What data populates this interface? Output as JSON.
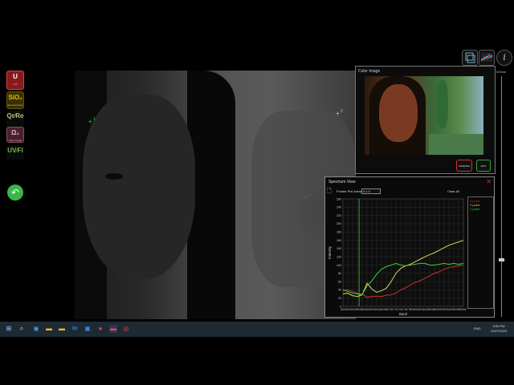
{
  "tools": [
    {
      "icon": "U",
      "label": "UVF",
      "icon_name": "uv-fluorescence-icon"
    },
    {
      "icon": "SiO₂",
      "label": "Spectral Cube",
      "icon_name": "spectral-cube-icon"
    },
    {
      "icon": "Qr⁄Re",
      "label": "",
      "icon_name": "ratio-icon"
    },
    {
      "icon": "Ω₂",
      "label": "Color Image",
      "icon_name": "color-image-icon"
    },
    {
      "icon": "UV⁄Fl",
      "label": "",
      "icon_name": "uv-icon"
    }
  ],
  "back_button": {
    "icon": "↶"
  },
  "markers": [
    {
      "id": "1",
      "color": "#3bd23b"
    },
    {
      "id": "2",
      "color": "#d8d85a"
    },
    {
      "id": "3",
      "color": "#d03030"
    }
  ],
  "top_right_icons": {
    "layers": "layers-icon",
    "spectrum": "spectrum-icon",
    "info": "i"
  },
  "color_image": {
    "title": "Color Image",
    "btn_1": "SAVE/IMG",
    "btn_2": "EXIT"
  },
  "scale": {
    "label": "500nm"
  },
  "spectrum_view": {
    "title": "Spectrum View",
    "close_icon": "✕",
    "mode_label": "Pointer Pixl Areas:",
    "mode_value": "4 x 4",
    "clear_all": "Clear All",
    "legend": [
      {
        "label": "3 point",
        "color": "#d03030"
      },
      {
        "label": "2 point",
        "color": "#d8d85a"
      },
      {
        "label": "1 point",
        "color": "#3bd23b"
      }
    ]
  },
  "chart_data": {
    "type": "line",
    "title": "",
    "xlabel": "Band",
    "ylabel": "Intensity",
    "xlim": [
      500,
      1000
    ],
    "ylim": [
      0,
      260
    ],
    "xticks": [
      500,
      520,
      540,
      560,
      580,
      600,
      620,
      640,
      660,
      680,
      700,
      720,
      740,
      760,
      780,
      800,
      820,
      840,
      860,
      880,
      900,
      920,
      940,
      960,
      980,
      1000
    ],
    "yticks": [
      0,
      20,
      40,
      60,
      80,
      100,
      120,
      140,
      160,
      180,
      200,
      220,
      240,
      260
    ],
    "grid": true,
    "vline_x": 567,
    "x": [
      500,
      520,
      540,
      560,
      580,
      600,
      620,
      640,
      660,
      680,
      700,
      720,
      740,
      760,
      780,
      800,
      820,
      840,
      860,
      880,
      900,
      920,
      940,
      960,
      980,
      1000
    ],
    "series": [
      {
        "name": "3 point",
        "color": "#d03030",
        "values": [
          38,
          40,
          36,
          32,
          30,
          22,
          24,
          25,
          24,
          27,
          28,
          32,
          40,
          45,
          52,
          58,
          62,
          68,
          74,
          80,
          84,
          90,
          94,
          96,
          98,
          100
        ]
      },
      {
        "name": "2 point",
        "color": "#d8d85a",
        "values": [
          30,
          32,
          26,
          24,
          28,
          56,
          42,
          34,
          38,
          44,
          60,
          80,
          92,
          98,
          102,
          108,
          114,
          120,
          125,
          130,
          136,
          142,
          148,
          152,
          156,
          160
        ]
      },
      {
        "name": "1 point",
        "color": "#3bd23b",
        "values": [
          40,
          36,
          32,
          30,
          28,
          50,
          62,
          78,
          90,
          96,
          100,
          104,
          100,
          98,
          100,
          102,
          104,
          104,
          100,
          100,
          102,
          104,
          102,
          104,
          102,
          104
        ]
      }
    ]
  },
  "taskbar": {
    "start_icon": "⊞",
    "search_icon": "⌕",
    "lang": "ENG",
    "time": "9:09 PM",
    "date": "10/27/2023"
  }
}
